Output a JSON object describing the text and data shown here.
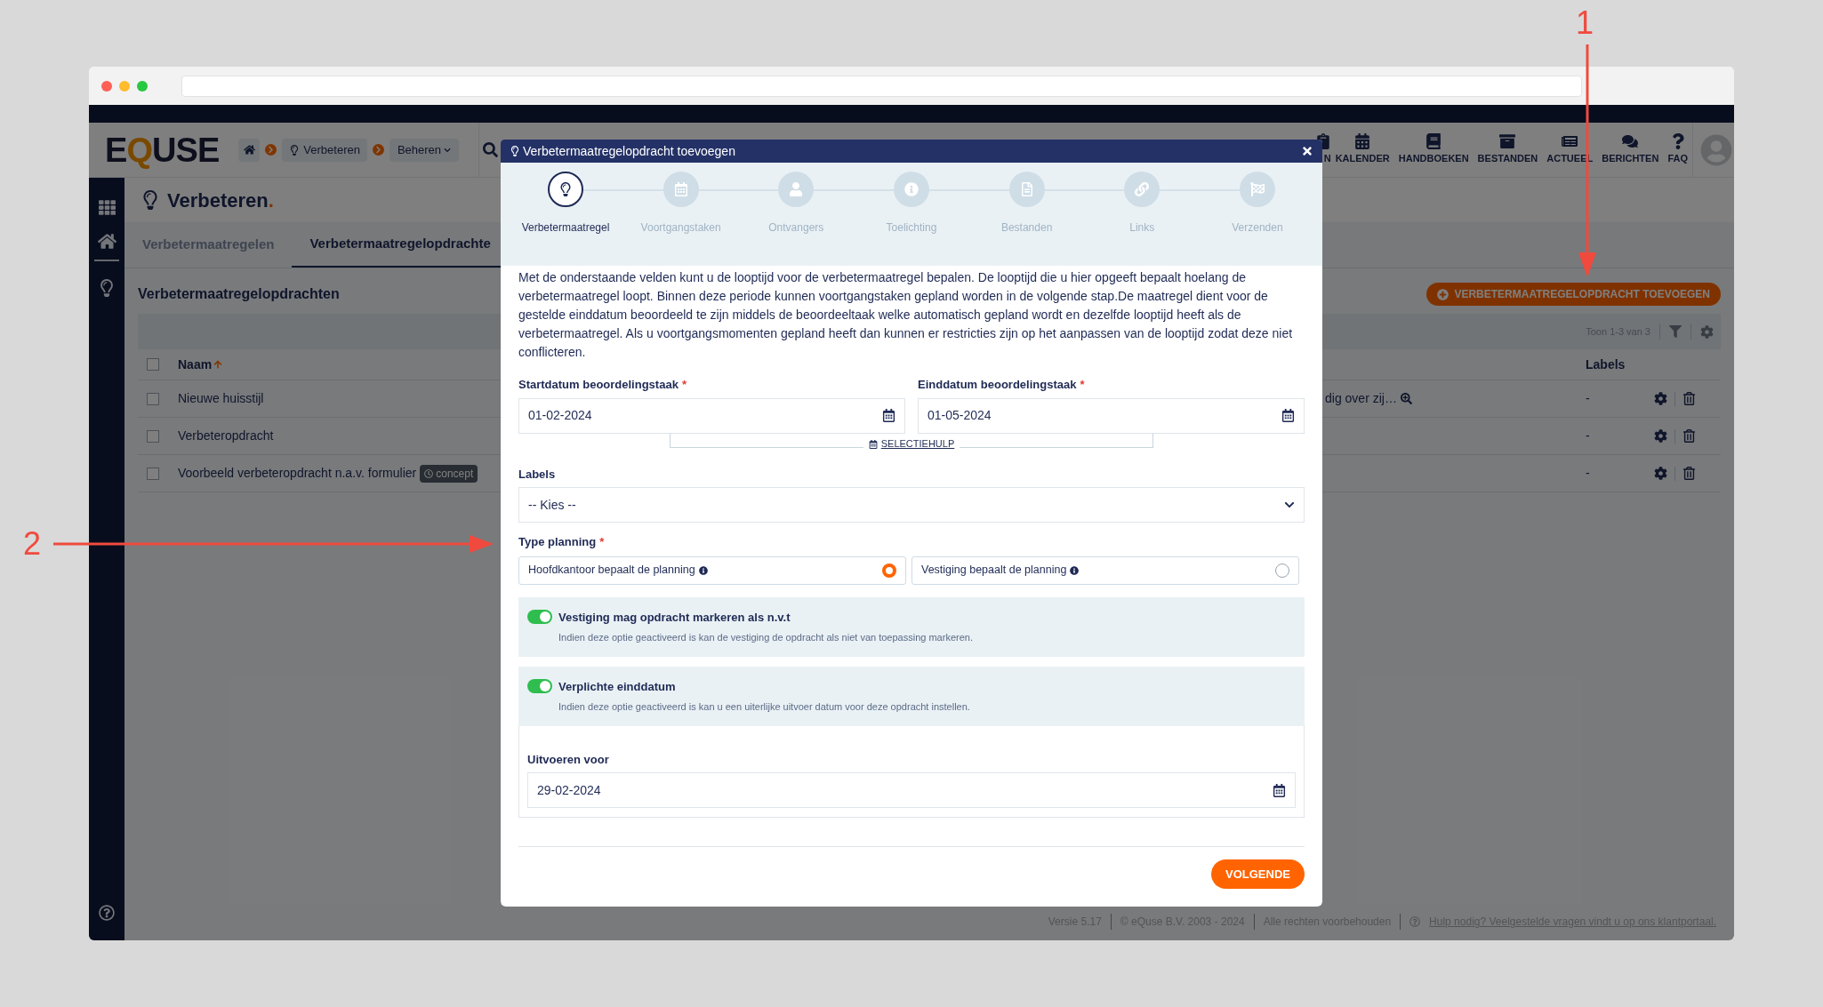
{
  "annotations": [
    {
      "label": "1"
    },
    {
      "label": "2"
    }
  ],
  "app": {
    "logo": "EQUSE",
    "breadcrumbs": [
      {
        "kind": "home"
      },
      {
        "kind": "page",
        "label": "Verbeteren"
      },
      {
        "kind": "menu",
        "label": "Beheren"
      }
    ],
    "nav_items": [
      {
        "kind": "clipboard",
        "label": "N"
      },
      {
        "kind": "calendar",
        "label": "KALENDER"
      },
      {
        "kind": "book",
        "label": "HANDBOEKEN"
      },
      {
        "kind": "archive",
        "label": "BESTANDEN"
      },
      {
        "kind": "news",
        "label": "ACTUEEL"
      },
      {
        "kind": "chat",
        "label": "BERICHTEN"
      },
      {
        "kind": "question",
        "label": "FAQ"
      }
    ],
    "page_title": "Verbeteren",
    "page_title_dot": ".",
    "tabs": [
      {
        "label": "Verbetermaatregelen",
        "selected": false
      },
      {
        "label": "Verbetermaatregelopdrachte",
        "selected": true
      }
    ],
    "section_title": "Verbetermaatregelopdrachten",
    "add_button": "VERBETERMAATREGELOPDRACHT TOEVOEGEN",
    "pagination": "Toon 1-3 van 3",
    "table": {
      "select_all_checked": false,
      "columns": [
        {
          "label": "Naam",
          "sort_ascending": true
        },
        {
          "label": "Labels"
        }
      ],
      "rows": [
        {
          "checked": false,
          "name": "Nieuwe huisstijl",
          "column_3": "dig over zij…",
          "labels": "-"
        },
        {
          "checked": false,
          "name": "Verbeteropdracht",
          "labels": "-"
        },
        {
          "checked": false,
          "name": "Voorbeeld verbeteropdracht n.a.v. formulier",
          "badge": "concept",
          "labels": "-"
        }
      ]
    },
    "footer": {
      "version": "Versie 5.17",
      "copyright": "© eQuse B.V. 2003 - 2024",
      "rights": "Alle rechten voorbehouden",
      "help_link": "Hulp nodig? Veelgestelde vragen vindt u op ons klantportaal."
    }
  },
  "modal": {
    "title": "Verbetermaatregelopdracht toevoegen",
    "steps": [
      {
        "kind": "bulb",
        "label": "Verbetermaatregel",
        "selected": true
      },
      {
        "kind": "calendar",
        "label": "Voortgangstaken",
        "selected": false
      },
      {
        "kind": "user",
        "label": "Ontvangers",
        "selected": false
      },
      {
        "kind": "info",
        "label": "Toelichting",
        "selected": false
      },
      {
        "kind": "file",
        "label": "Bestanden",
        "selected": false
      },
      {
        "kind": "link",
        "label": "Links",
        "selected": false
      },
      {
        "kind": "flag",
        "label": "Verzenden",
        "selected": false
      }
    ],
    "intro": "Met de onderstaande velden kunt u de looptijd voor de verbetermaatregel bepalen. De looptijd die u hier opgeeft bepaalt hoelang de verbetermaatregel loopt. Binnen deze periode kunnen voortgangstaken gepland worden in de volgende stap.De maatregel dient voor de gestelde einddatum beoordeeld te zijn middels de beoordeeltaak welke automatisch gepland wordt en dezelfde looptijd heeft als de verbetermaatregel. Als u voortgangsmomenten gepland heeft dan kunnen er restricties zijn op het aanpassen van de looptijd zodat deze niet conflicteren.",
    "dates": [
      {
        "label": "Startdatum beoordelingstaak",
        "required_mark": "*",
        "value": "01-02-2024"
      },
      {
        "label": "Einddatum beoordelingstaak",
        "required_mark": "*",
        "value": "01-05-2024"
      }
    ],
    "helper_link": "SELECTIEHULP",
    "labels_field": {
      "label": "Labels",
      "value": "-- Kies --"
    },
    "planning": {
      "label": "Type planning",
      "required_mark": "*",
      "options": [
        {
          "label": "Hoofdkantoor bepaalt de planning",
          "selected": true
        },
        {
          "label": "Vestiging bepaalt de planning",
          "selected": false
        }
      ]
    },
    "toggles": [
      {
        "title": "Vestiging mag opdracht markeren als n.v.t",
        "description": "Indien deze optie geactiveerd is kan de vestiging de opdracht als niet van toepassing markeren.",
        "on": true
      },
      {
        "title": "Verplichte einddatum",
        "description": "Indien deze optie geactiveerd is kan u een uiterlijke uitvoer datum voor deze opdracht instellen.",
        "on": true
      }
    ],
    "deadline": {
      "label": "Uitvoeren voor",
      "value": "29-02-2024"
    },
    "next_button": "VOLGENDE"
  }
}
